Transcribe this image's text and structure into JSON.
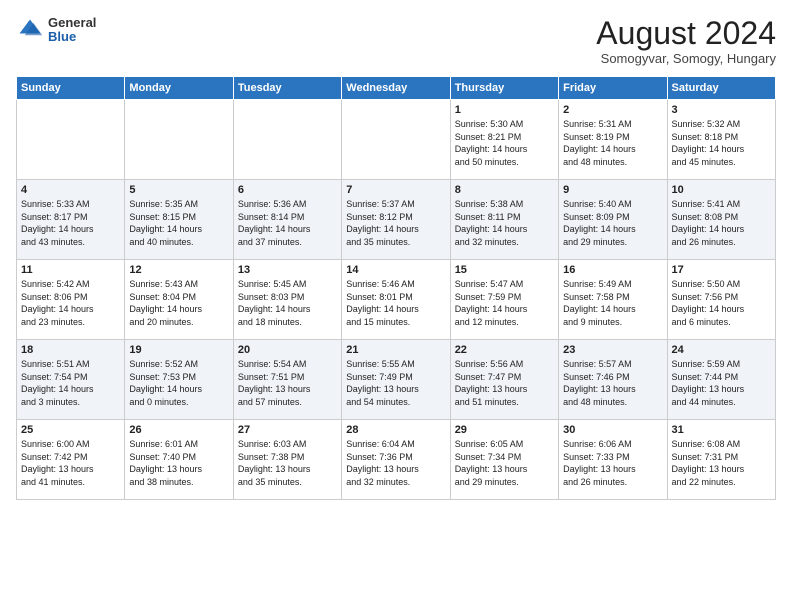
{
  "header": {
    "logo": {
      "general": "General",
      "blue": "Blue"
    },
    "title": "August 2024",
    "location": "Somogyvar, Somogy, Hungary"
  },
  "days_of_week": [
    "Sunday",
    "Monday",
    "Tuesday",
    "Wednesday",
    "Thursday",
    "Friday",
    "Saturday"
  ],
  "weeks": [
    [
      {
        "day": "",
        "content": ""
      },
      {
        "day": "",
        "content": ""
      },
      {
        "day": "",
        "content": ""
      },
      {
        "day": "",
        "content": ""
      },
      {
        "day": "1",
        "content": "Sunrise: 5:30 AM\nSunset: 8:21 PM\nDaylight: 14 hours\nand 50 minutes."
      },
      {
        "day": "2",
        "content": "Sunrise: 5:31 AM\nSunset: 8:19 PM\nDaylight: 14 hours\nand 48 minutes."
      },
      {
        "day": "3",
        "content": "Sunrise: 5:32 AM\nSunset: 8:18 PM\nDaylight: 14 hours\nand 45 minutes."
      }
    ],
    [
      {
        "day": "4",
        "content": "Sunrise: 5:33 AM\nSunset: 8:17 PM\nDaylight: 14 hours\nand 43 minutes."
      },
      {
        "day": "5",
        "content": "Sunrise: 5:35 AM\nSunset: 8:15 PM\nDaylight: 14 hours\nand 40 minutes."
      },
      {
        "day": "6",
        "content": "Sunrise: 5:36 AM\nSunset: 8:14 PM\nDaylight: 14 hours\nand 37 minutes."
      },
      {
        "day": "7",
        "content": "Sunrise: 5:37 AM\nSunset: 8:12 PM\nDaylight: 14 hours\nand 35 minutes."
      },
      {
        "day": "8",
        "content": "Sunrise: 5:38 AM\nSunset: 8:11 PM\nDaylight: 14 hours\nand 32 minutes."
      },
      {
        "day": "9",
        "content": "Sunrise: 5:40 AM\nSunset: 8:09 PM\nDaylight: 14 hours\nand 29 minutes."
      },
      {
        "day": "10",
        "content": "Sunrise: 5:41 AM\nSunset: 8:08 PM\nDaylight: 14 hours\nand 26 minutes."
      }
    ],
    [
      {
        "day": "11",
        "content": "Sunrise: 5:42 AM\nSunset: 8:06 PM\nDaylight: 14 hours\nand 23 minutes."
      },
      {
        "day": "12",
        "content": "Sunrise: 5:43 AM\nSunset: 8:04 PM\nDaylight: 14 hours\nand 20 minutes."
      },
      {
        "day": "13",
        "content": "Sunrise: 5:45 AM\nSunset: 8:03 PM\nDaylight: 14 hours\nand 18 minutes."
      },
      {
        "day": "14",
        "content": "Sunrise: 5:46 AM\nSunset: 8:01 PM\nDaylight: 14 hours\nand 15 minutes."
      },
      {
        "day": "15",
        "content": "Sunrise: 5:47 AM\nSunset: 7:59 PM\nDaylight: 14 hours\nand 12 minutes."
      },
      {
        "day": "16",
        "content": "Sunrise: 5:49 AM\nSunset: 7:58 PM\nDaylight: 14 hours\nand 9 minutes."
      },
      {
        "day": "17",
        "content": "Sunrise: 5:50 AM\nSunset: 7:56 PM\nDaylight: 14 hours\nand 6 minutes."
      }
    ],
    [
      {
        "day": "18",
        "content": "Sunrise: 5:51 AM\nSunset: 7:54 PM\nDaylight: 14 hours\nand 3 minutes."
      },
      {
        "day": "19",
        "content": "Sunrise: 5:52 AM\nSunset: 7:53 PM\nDaylight: 14 hours\nand 0 minutes."
      },
      {
        "day": "20",
        "content": "Sunrise: 5:54 AM\nSunset: 7:51 PM\nDaylight: 13 hours\nand 57 minutes."
      },
      {
        "day": "21",
        "content": "Sunrise: 5:55 AM\nSunset: 7:49 PM\nDaylight: 13 hours\nand 54 minutes."
      },
      {
        "day": "22",
        "content": "Sunrise: 5:56 AM\nSunset: 7:47 PM\nDaylight: 13 hours\nand 51 minutes."
      },
      {
        "day": "23",
        "content": "Sunrise: 5:57 AM\nSunset: 7:46 PM\nDaylight: 13 hours\nand 48 minutes."
      },
      {
        "day": "24",
        "content": "Sunrise: 5:59 AM\nSunset: 7:44 PM\nDaylight: 13 hours\nand 44 minutes."
      }
    ],
    [
      {
        "day": "25",
        "content": "Sunrise: 6:00 AM\nSunset: 7:42 PM\nDaylight: 13 hours\nand 41 minutes."
      },
      {
        "day": "26",
        "content": "Sunrise: 6:01 AM\nSunset: 7:40 PM\nDaylight: 13 hours\nand 38 minutes."
      },
      {
        "day": "27",
        "content": "Sunrise: 6:03 AM\nSunset: 7:38 PM\nDaylight: 13 hours\nand 35 minutes."
      },
      {
        "day": "28",
        "content": "Sunrise: 6:04 AM\nSunset: 7:36 PM\nDaylight: 13 hours\nand 32 minutes."
      },
      {
        "day": "29",
        "content": "Sunrise: 6:05 AM\nSunset: 7:34 PM\nDaylight: 13 hours\nand 29 minutes."
      },
      {
        "day": "30",
        "content": "Sunrise: 6:06 AM\nSunset: 7:33 PM\nDaylight: 13 hours\nand 26 minutes."
      },
      {
        "day": "31",
        "content": "Sunrise: 6:08 AM\nSunset: 7:31 PM\nDaylight: 13 hours\nand 22 minutes."
      }
    ]
  ]
}
